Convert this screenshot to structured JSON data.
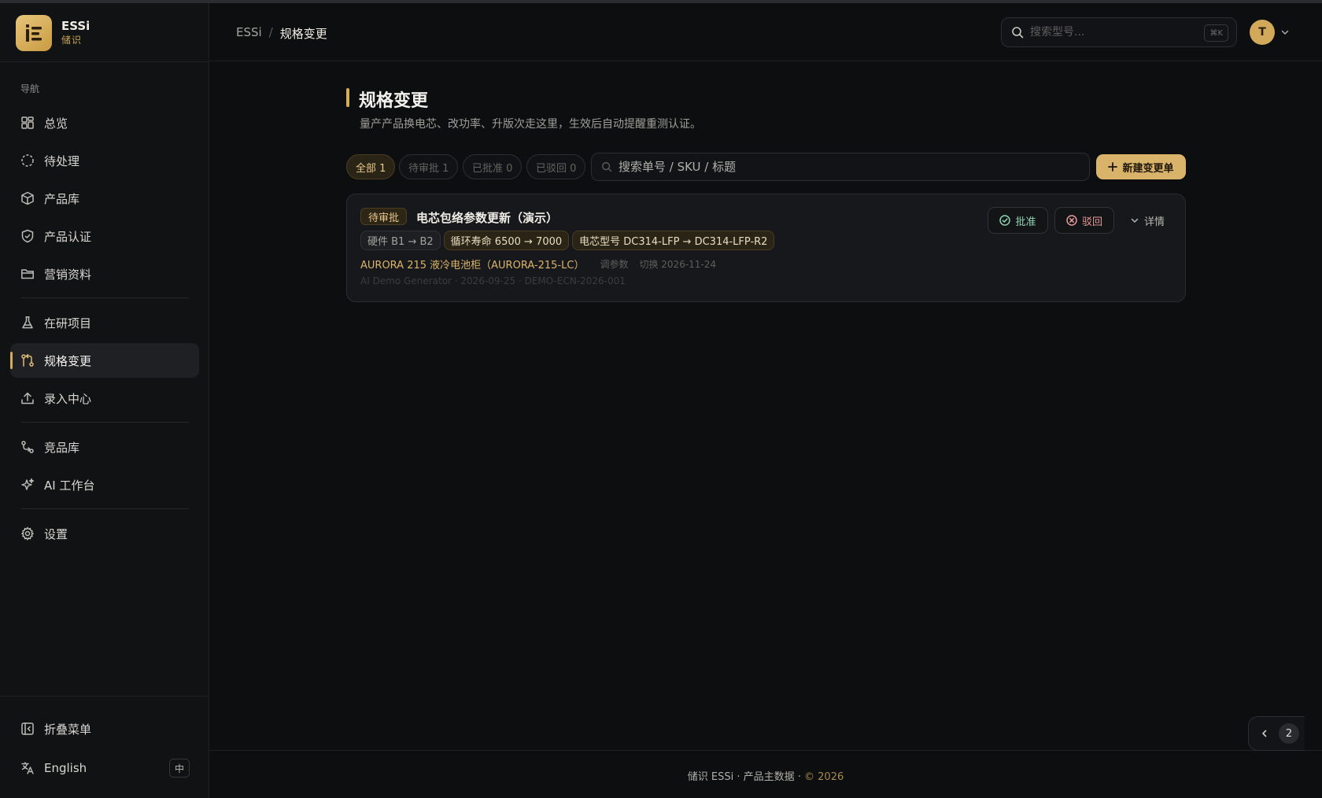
{
  "brand": {
    "name": "ESSi",
    "subtitle": "储识"
  },
  "nav": {
    "section_label": "导航",
    "items": [
      {
        "label": "总览",
        "icon": "dashboard-icon"
      },
      {
        "label": "待处理",
        "icon": "pending-icon"
      },
      {
        "label": "产品库",
        "icon": "package-icon"
      },
      {
        "label": "产品认证",
        "icon": "shield-icon"
      },
      {
        "label": "营销资料",
        "icon": "folder-icon"
      },
      {
        "label": "在研项目",
        "icon": "flask-icon"
      },
      {
        "label": "规格变更",
        "icon": "git-compare-icon",
        "active": true
      },
      {
        "label": "录入中心",
        "icon": "upload-icon"
      },
      {
        "label": "竞品库",
        "icon": "compare-icon"
      },
      {
        "label": "AI 工作台",
        "icon": "sparkles-icon"
      },
      {
        "label": "设置",
        "icon": "gear-icon"
      }
    ],
    "collapse_label": "折叠菜单",
    "language_label": "English",
    "language_badge": "中"
  },
  "header": {
    "breadcrumb_root": "ESSi",
    "breadcrumb_sep": "/",
    "breadcrumb_current": "规格变更",
    "search_placeholder": "搜索型号...",
    "search_shortcut": "⌘K",
    "avatar_initial": "T"
  },
  "page": {
    "title": "规格变更",
    "description": "量产产品换电芯、改功率、升版次走这里，生效后自动提醒重测认证。"
  },
  "filters": {
    "chips": [
      {
        "label": "全部 1",
        "active": true
      },
      {
        "label": "待审批 1"
      },
      {
        "label": "已批准 0"
      },
      {
        "label": "已驳回 0"
      }
    ],
    "search_placeholder": "搜索单号 / SKU / 标题",
    "new_button": "新建变更单"
  },
  "card": {
    "status": "待审批",
    "title": "电芯包络参数更新（演示）",
    "tags": [
      {
        "label": "硬件 B1 → B2"
      },
      {
        "label": "循环寿命 6500 → 7000",
        "gold": true
      },
      {
        "label": "电芯型号 DC314-LFP → DC314-LFP-R2",
        "gold": true
      }
    ],
    "product": "AURORA 215 液冷电池柜（AURORA-215-LC）",
    "change_type": "调参数",
    "switch_date": "切换 2026-11-24",
    "meta": "AI Demo Generator · 2026-09-25 · DEMO-ECN-2026-001",
    "approve_label": "批准",
    "reject_label": "驳回",
    "detail_label": "详情"
  },
  "footer": {
    "text": "储识 ESSi · 产品主数据 · ",
    "copyright": "© 2026"
  },
  "pager": {
    "page": "2"
  },
  "colors": {
    "accent": "#d6ad55",
    "approve": "#8dd3b0",
    "reject": "#e79a9a",
    "background": "#0d0e10"
  }
}
